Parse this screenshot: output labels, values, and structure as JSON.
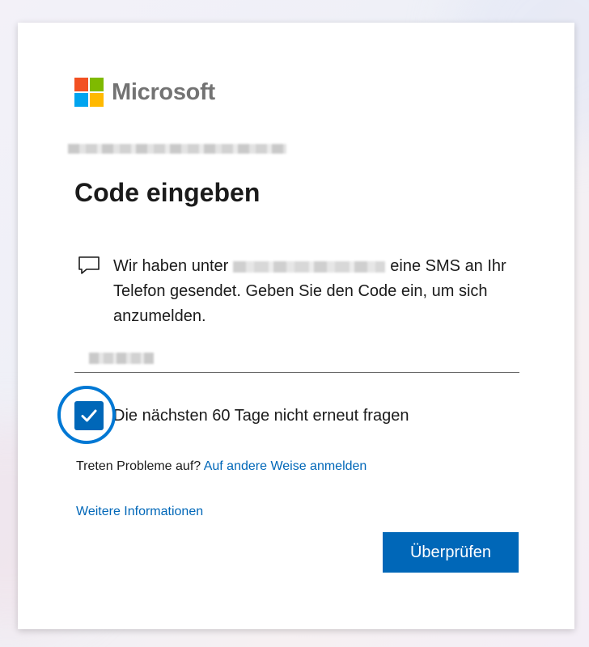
{
  "brand": {
    "name": "Microsoft",
    "logo_colors": [
      "#f25022",
      "#7fba00",
      "#00a4ef",
      "#ffb900"
    ]
  },
  "page": {
    "title": "Code eingeben"
  },
  "message": {
    "before_number": "Wir haben unter",
    "after_number": "eine SMS an Ihr Telefon gesendet. Geben Sie den Code ein, um sich anzumelden."
  },
  "code_field": {
    "value": ""
  },
  "remember": {
    "label": "Die nächsten 60 Tage nicht erneut fragen",
    "checked": true
  },
  "trouble": {
    "prefix": "Treten Probleme auf?",
    "link": "Auf andere Weise anmelden"
  },
  "more_info": "Weitere Informationen",
  "verify_button": "Überprüfen",
  "colors": {
    "accent": "#0067b8",
    "focus_ring": "#0078d4"
  }
}
